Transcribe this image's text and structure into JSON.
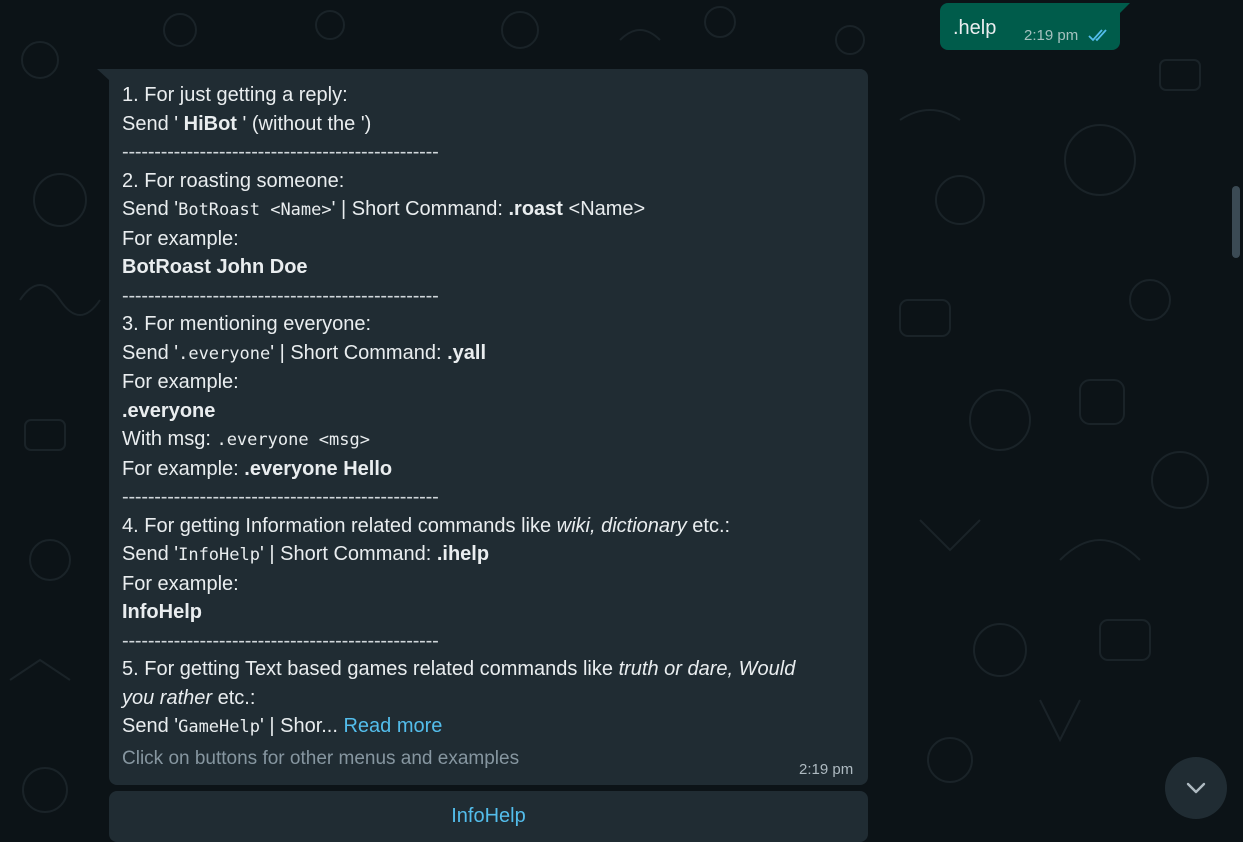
{
  "sent_message": {
    "text": ".help",
    "time": "2:19 pm",
    "status_icon": "double-check-icon",
    "tick_color": "#53bdeb"
  },
  "bot_message": {
    "section1": {
      "heading": "1. For just getting a reply:",
      "send_prefix": "Send ' ",
      "command": "HiBot",
      "send_suffix": " ' (without the ')"
    },
    "separator": "-------------------------------------------------",
    "section2": {
      "heading": "2. For roasting someone:",
      "send_open": "Send '",
      "command": "BotRoast <Name>",
      "send_close": "' | Short Command: ",
      "short": ".roast",
      "short_arg": " <Name>",
      "example_label": "For example:",
      "example": "BotRoast John Doe"
    },
    "section3": {
      "heading": "3. For mentioning everyone:",
      "send_open": "Send '",
      "command": ".everyone",
      "send_close": "' | Short Command: ",
      "short": ".yall",
      "example_label": "For example:",
      "example": ".everyone",
      "with_msg_label": "With msg: ",
      "with_msg_cmd": ".everyone <msg>",
      "example2_label": "For example: ",
      "example2": ".everyone Hello"
    },
    "section4": {
      "heading_prefix": "4. For getting Information related commands like ",
      "heading_italic": "wiki, dictionary",
      "heading_suffix": " etc.:",
      "send_open": "Send '",
      "command": "InfoHelp",
      "send_close": "' | Short Command: ",
      "short": ".ihelp",
      "example_label": "For example:",
      "example": "InfoHelp"
    },
    "section5": {
      "heading_prefix": "5. For getting Text based games related commands like ",
      "heading_italic_1": "truth or dare, Would",
      "heading_italic_2": "you rather",
      "heading_suffix": " etc.:",
      "send_open": "Send '",
      "command": "GameHelp",
      "send_close": "' | Shor... ",
      "read_more": "Read more"
    },
    "footer": "Click on buttons for other menus and examples",
    "time": "2:19 pm"
  },
  "reply_button": {
    "label": "InfoHelp"
  },
  "scroll_down_icon": "chevron-down-icon",
  "colors": {
    "background": "#0c1317",
    "incoming_bubble": "#202c33",
    "outgoing_bubble": "#005c4b",
    "link": "#53bdeb"
  }
}
